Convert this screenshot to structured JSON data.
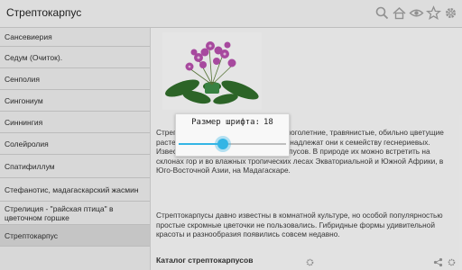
{
  "header": {
    "title": "Стрептокарпус",
    "icons": [
      "search-icon",
      "home-icon",
      "eye-icon",
      "star-icon",
      "gear-icon"
    ]
  },
  "sidebar": {
    "items": [
      {
        "label": "Сансевиерия"
      },
      {
        "label": "Седум (Очиток)."
      },
      {
        "label": "Сенполия"
      },
      {
        "label": "Сингониум"
      },
      {
        "label": "Синнингия"
      },
      {
        "label": "Солейролия"
      },
      {
        "label": "Спатифиллум"
      },
      {
        "label": "Стефанотис, мадагаскарский жасмин"
      },
      {
        "label": "Стрелиция - \"райская птица\" в цветочном горшке"
      },
      {
        "label": "Стрептокарпус",
        "active": true
      }
    ]
  },
  "content": {
    "paragraph1": "Стрептокарпусы, или мыльнянки, – многолетние, травянистые, обильно цветущие растения. С фиалками (сенполии) принадлежат они к семейству геснериевых. Известно около 130 видов стрептокарпусов. В природе их можно встретить на склонах гор и во влажных тропических лесах Экваториальной и Южной Африки, в Юго-Восточной Азии, на Мадагаскаре.",
    "paragraph2": "Стрептокарпусы давно известны в комнатной культуре, но особой популярностью простые скромные цветочки не пользовались. Гибридные формы удивительной красоты и разнообразия появились совсем недавно.",
    "catalog_heading": "Каталог стрептокарпусов",
    "image": "flower-photo"
  },
  "font_dialog": {
    "label": "Размер шрифта:",
    "value": "18",
    "slider_fraction": 0.41,
    "accent_color": "#33b5e5"
  },
  "footer": {
    "icons": [
      "gear-icon",
      "share-icon",
      "settings-icon"
    ]
  }
}
